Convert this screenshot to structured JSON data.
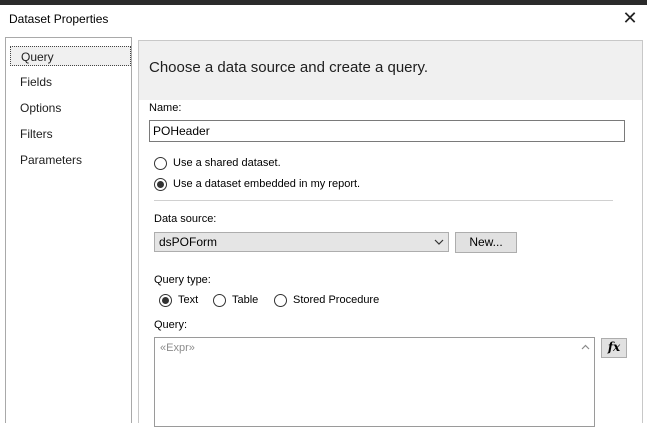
{
  "window": {
    "title": "Dataset Properties"
  },
  "nav": {
    "items": [
      {
        "label": "Query",
        "selected": true
      },
      {
        "label": "Fields",
        "selected": false
      },
      {
        "label": "Options",
        "selected": false
      },
      {
        "label": "Filters",
        "selected": false
      },
      {
        "label": "Parameters",
        "selected": false
      }
    ]
  },
  "main": {
    "heading": "Choose a data source and create a query.",
    "name_label": "Name:",
    "name_value": "POHeader",
    "dataset_options": [
      {
        "label": "Use a shared dataset.",
        "checked": false
      },
      {
        "label": "Use a dataset embedded in my report.",
        "checked": true
      }
    ],
    "data_source_label": "Data source:",
    "data_source_value": "dsPOForm",
    "new_button": "New...",
    "query_type_label": "Query type:",
    "query_types": [
      {
        "label": "Text",
        "checked": true
      },
      {
        "label": "Table",
        "checked": false
      },
      {
        "label": "Stored Procedure",
        "checked": false
      }
    ],
    "query_label": "Query:",
    "query_value": "«Expr»",
    "expression_button": "fx"
  },
  "colors": {
    "panel_bg": "#f0f0f0",
    "border": "#a9a9a9",
    "button_bg": "#e1e1e1"
  }
}
